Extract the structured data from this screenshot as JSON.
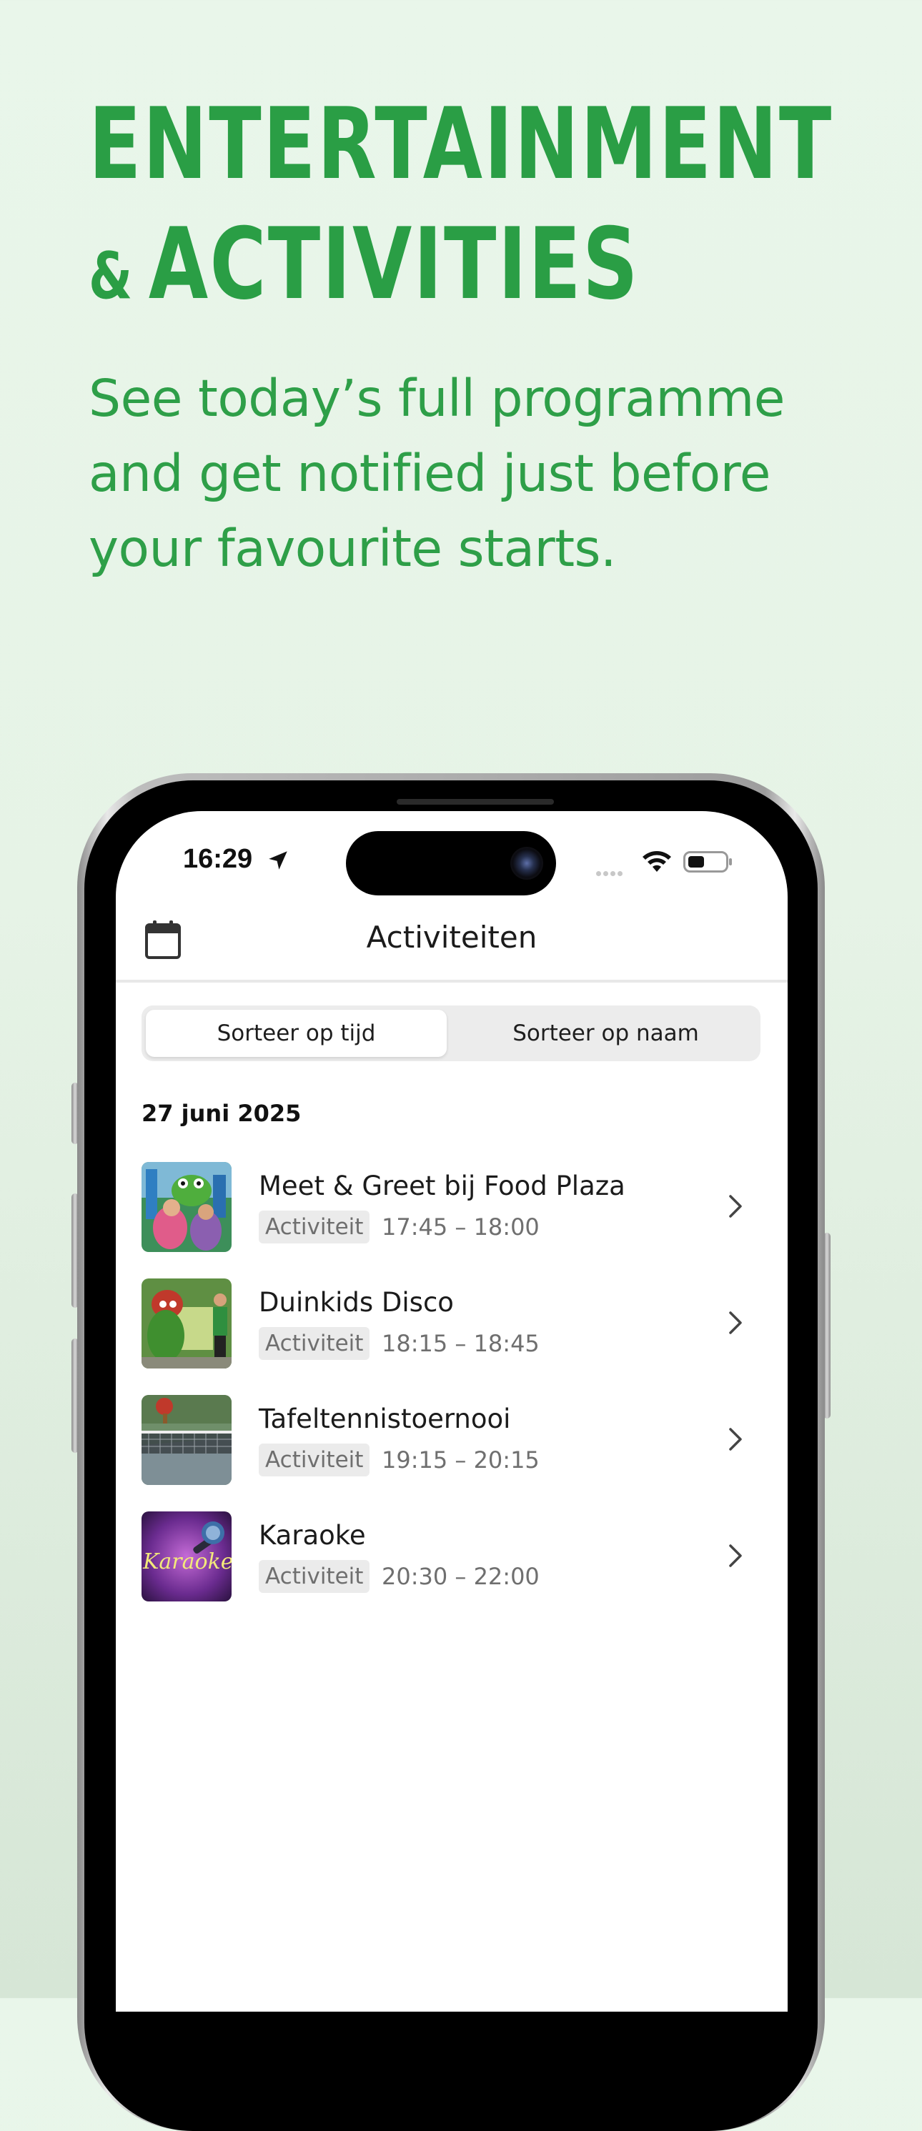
{
  "promo": {
    "headline_line1": "ENTERTAINMENT",
    "headline_amp": "&",
    "headline_line2": "ACTIVITIES",
    "subline": "See today’s full programme and get notified just before your favourite starts."
  },
  "status_bar": {
    "time": "16:29",
    "icons": [
      "location-arrow-icon",
      "signal-dots-icon",
      "wifi-icon",
      "battery-icon"
    ]
  },
  "navbar": {
    "title": "Activiteiten",
    "left_icon": "calendar-icon"
  },
  "sort_control": {
    "options": [
      "Sorteer op tijd",
      "Sorteer op naam"
    ],
    "selected": "Sorteer op tijd"
  },
  "date_header": "27 juni 2025",
  "activities": [
    {
      "title": "Meet & Greet bij Food Plaza",
      "category": "Activiteit",
      "time": "17:45 – 18:00"
    },
    {
      "title": "Duinkids Disco",
      "category": "Activiteit",
      "time": "18:15 – 18:45"
    },
    {
      "title": "Tafeltennistoernooi",
      "category": "Activiteit",
      "time": "19:15 – 20:15"
    },
    {
      "title": "Karaoke",
      "category": "Activiteit",
      "time": "20:30 – 22:00"
    }
  ],
  "thumb_text": {
    "karaoke": "Karaoke"
  },
  "colors": {
    "brand_green": "#2a9e45",
    "background": "#e9f6ea"
  }
}
